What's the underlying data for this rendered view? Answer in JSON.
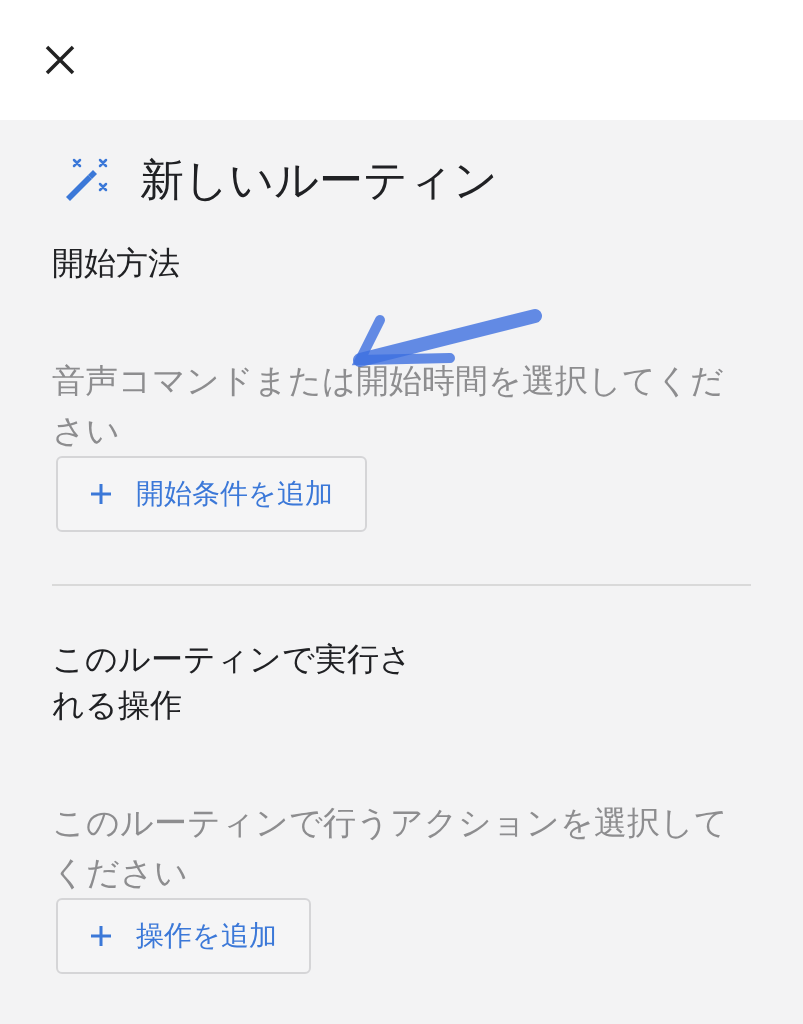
{
  "title": "新しいルーティン",
  "sections": [
    {
      "heading": "開始方法",
      "hint": "音声コマンドまたは開始時間を選択してください",
      "button": "開始条件を追加"
    },
    {
      "heading": "このルーティンで実行される操作",
      "hint": "このルーティンで行うアクションを選択してください",
      "button": "操作を追加"
    }
  ]
}
